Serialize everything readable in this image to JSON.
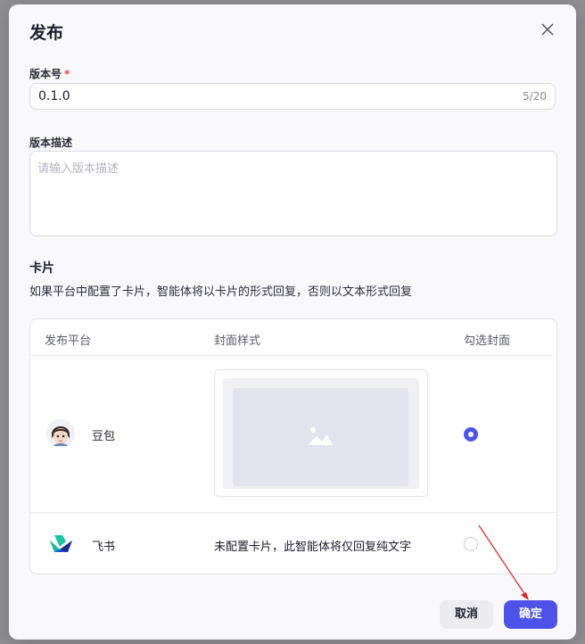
{
  "dialog": {
    "title": "发布",
    "close_icon": "close-icon"
  },
  "version": {
    "label": "版本号",
    "required_mark": "*",
    "value": "0.1.0",
    "counter": "5/20"
  },
  "description": {
    "label": "版本描述",
    "placeholder": "请输入版本描述",
    "value": ""
  },
  "card": {
    "title": "卡片",
    "desc": "如果平台中配置了卡片，智能体将以卡片的形式回复，否则以文本形式回复"
  },
  "table": {
    "headers": [
      "发布平台",
      "封面样式",
      "勾选封面"
    ],
    "rows": [
      {
        "platform": "豆包",
        "icon": "doubao-avatar-icon",
        "cover": "image-placeholder-icon",
        "checked": true
      },
      {
        "platform": "飞书",
        "icon": "feishu-logo-icon",
        "cover_text": "未配置卡片，此智能体将仅回复纯文字",
        "checked": false
      }
    ]
  },
  "footer": {
    "cancel_label": "取消",
    "confirm_label": "确定"
  },
  "colors": {
    "primary": "#4d53e8",
    "required": "#e5484d",
    "annotation_arrow": "#e02020"
  }
}
